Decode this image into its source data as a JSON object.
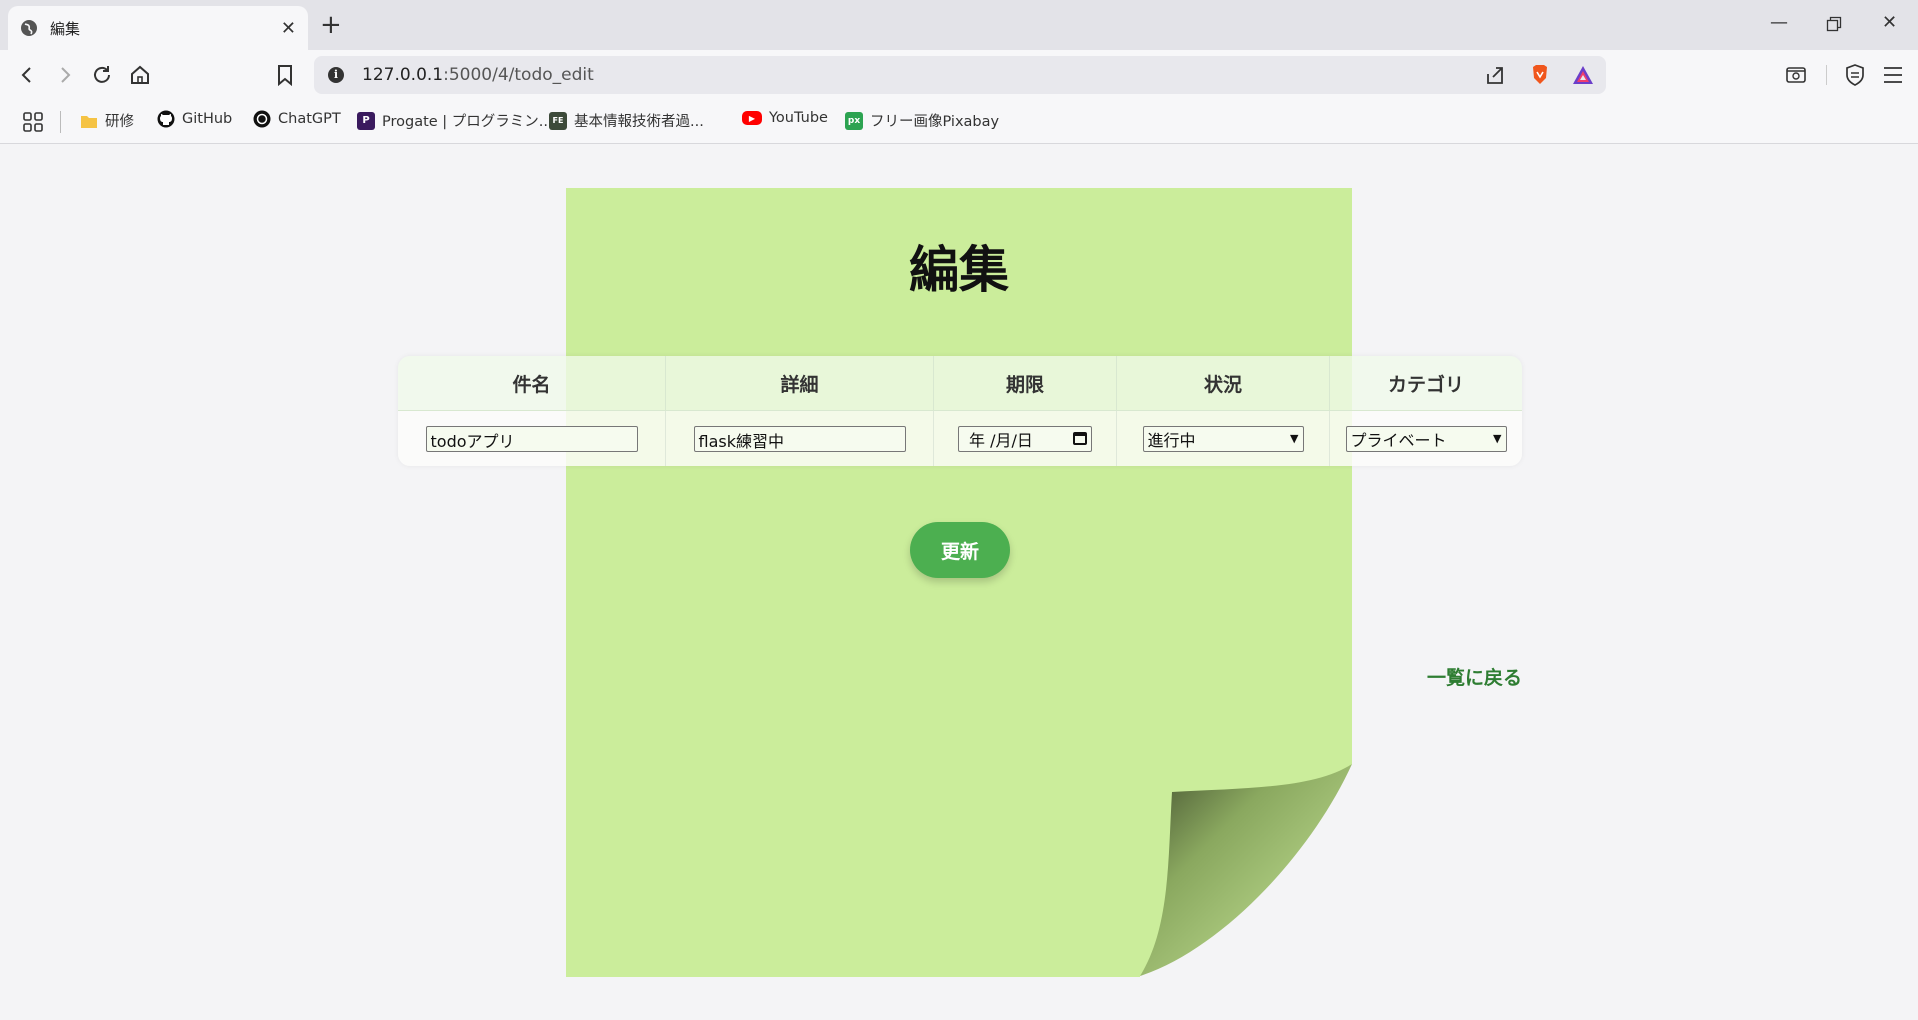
{
  "browser": {
    "tab_title": "編集",
    "url_host": "127.0.0.1",
    "url_rest": ":5000/4/todo_edit",
    "bookmarks": [
      {
        "label": "研修",
        "icon": "folder-icon"
      },
      {
        "label": "GitHub",
        "icon": "github-icon"
      },
      {
        "label": "ChatGPT",
        "icon": "chatgpt-icon"
      },
      {
        "label": "Progate | プログラミン...",
        "icon": "progate-icon"
      },
      {
        "label": "基本情報技術者過...",
        "icon": "fe-icon"
      },
      {
        "label": "YouTube",
        "icon": "youtube-icon"
      },
      {
        "label": "フリー画像Pixabay",
        "icon": "pixabay-icon"
      }
    ]
  },
  "page": {
    "title": "編集",
    "table": {
      "headers": [
        "件名",
        "詳細",
        "期限",
        "状況",
        "カテゴリ"
      ],
      "row": {
        "subject": "todoアプリ",
        "detail": "flask練習中",
        "deadline_placeholder": "年 /月/日",
        "status": "進行中",
        "category": "プライベート"
      }
    },
    "update_button": "更新",
    "back_link": "一覧に戻る"
  },
  "colors": {
    "paper": "#cbed9b",
    "button": "#4caf50",
    "link": "#2e7d32"
  }
}
